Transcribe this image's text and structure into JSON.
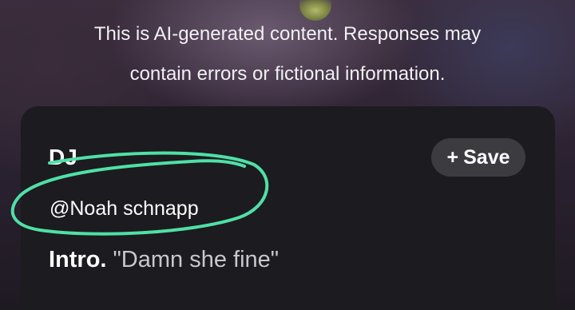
{
  "disclaimer": {
    "line1": "This is AI-generated content. Responses may",
    "line2": "contain errors or fictional information."
  },
  "card": {
    "title": "DJ",
    "save_button": {
      "icon": "+",
      "label": "Save"
    },
    "handle": "@Noah schnapp",
    "intro_label": "Intro.",
    "intro_quote": "\"Damn she fine\""
  },
  "annotation": {
    "color": "#4fe0a7",
    "icon": "hand-drawn-circle"
  }
}
